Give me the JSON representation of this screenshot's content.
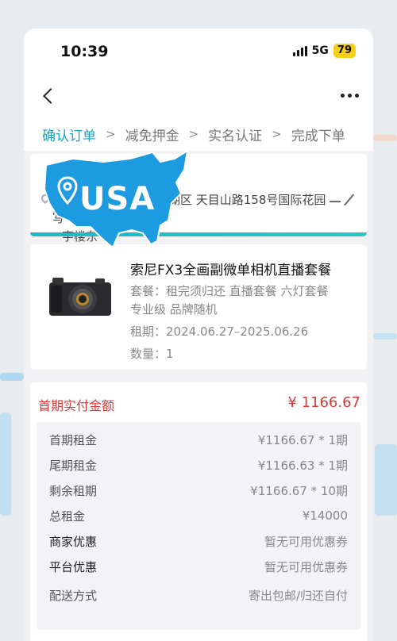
{
  "status_bar": {
    "time": "10:39",
    "network": "5G",
    "battery": "79"
  },
  "steps": [
    {
      "label": "确认订单",
      "active": true
    },
    {
      "label": "减免押金",
      "active": false
    },
    {
      "label": "实名认证",
      "active": false
    },
    {
      "label": "完成下单",
      "active": false
    }
  ],
  "address": {
    "name_partial": "61",
    "line": "湖区 天目山路158号国际花园写",
    "line2": "字楼东",
    "overlay_label": "USA"
  },
  "product": {
    "title": "索尼FX3全画副微单相机直播套餐",
    "package": "套餐：租完须归还 直播套餐 六灯套餐",
    "package_cont": "专业级 品牌随机",
    "period": "租期：2024.06.27–2025.06.26",
    "quantity": "数量：1"
  },
  "payment": {
    "head_label": "首期实付金额",
    "head_amount": "¥ 1166.67",
    "rows": [
      {
        "label": "首期租金",
        "value": "¥1166.67 * 1期"
      },
      {
        "label": "尾期租金",
        "value": "¥1166.63 * 1期"
      },
      {
        "label": "剩余租期",
        "value": "¥1166.67 * 10期"
      },
      {
        "label": "总租金",
        "value": "¥14000"
      },
      {
        "label": "商家优惠",
        "value": "暂无可用优惠券"
      },
      {
        "label": "平台优惠",
        "value": "暂无可用优惠券"
      },
      {
        "label": "配送方式",
        "value": "寄出包邮/归还自付"
      }
    ]
  },
  "colors": {
    "accent": "#1aa7b8",
    "price": "#d93a3a",
    "overlay": "#1d9be0"
  }
}
